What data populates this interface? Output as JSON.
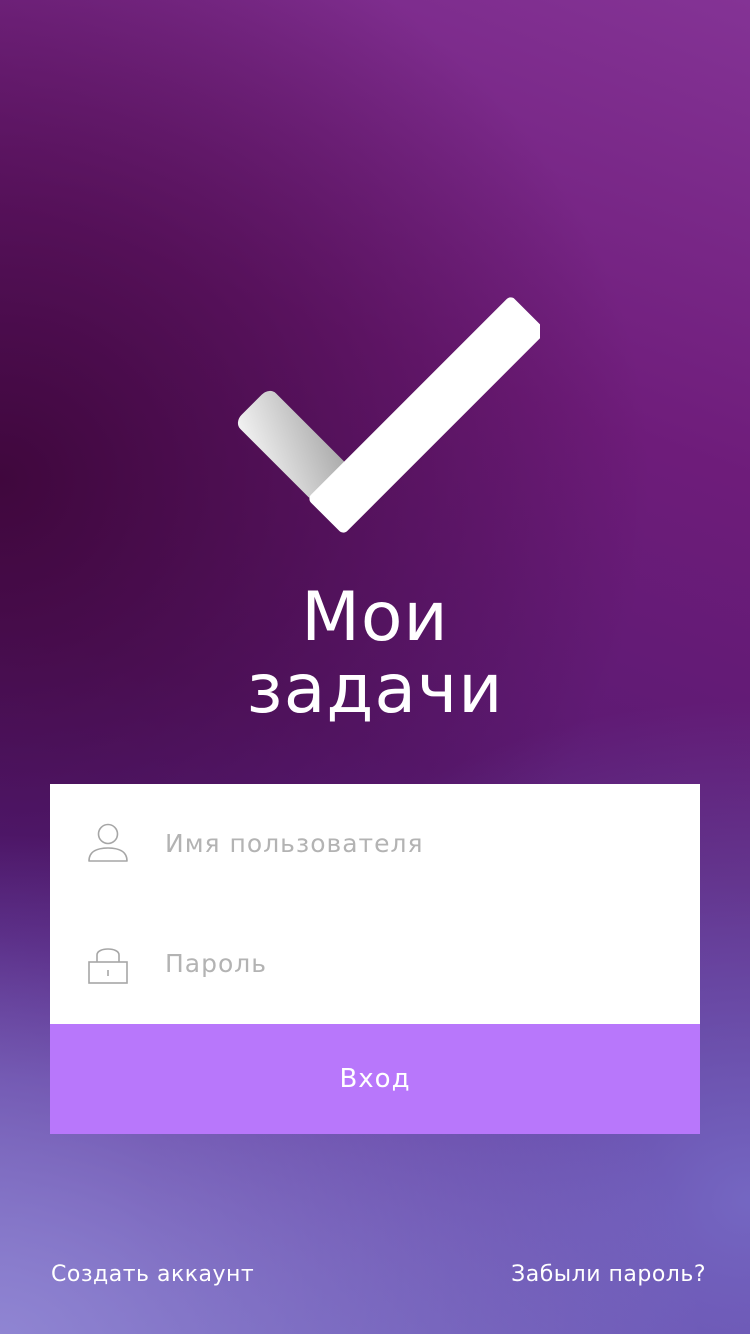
{
  "app": {
    "title_line1": "Мои",
    "title_line2": "задачи"
  },
  "form": {
    "username": {
      "placeholder": "Имя пользователя",
      "value": "",
      "icon": "user-icon"
    },
    "password": {
      "placeholder": "Пароль",
      "value": "",
      "icon": "lock-icon"
    },
    "submit_label": "Вход"
  },
  "footer": {
    "create_account": "Создать аккаунт",
    "forgot_password": "Забыли пароль?"
  },
  "colors": {
    "accent": "#b877fb",
    "text_on_dark": "#ffffff",
    "placeholder": "#b3b3b3",
    "icon": "#a6a6a6"
  }
}
